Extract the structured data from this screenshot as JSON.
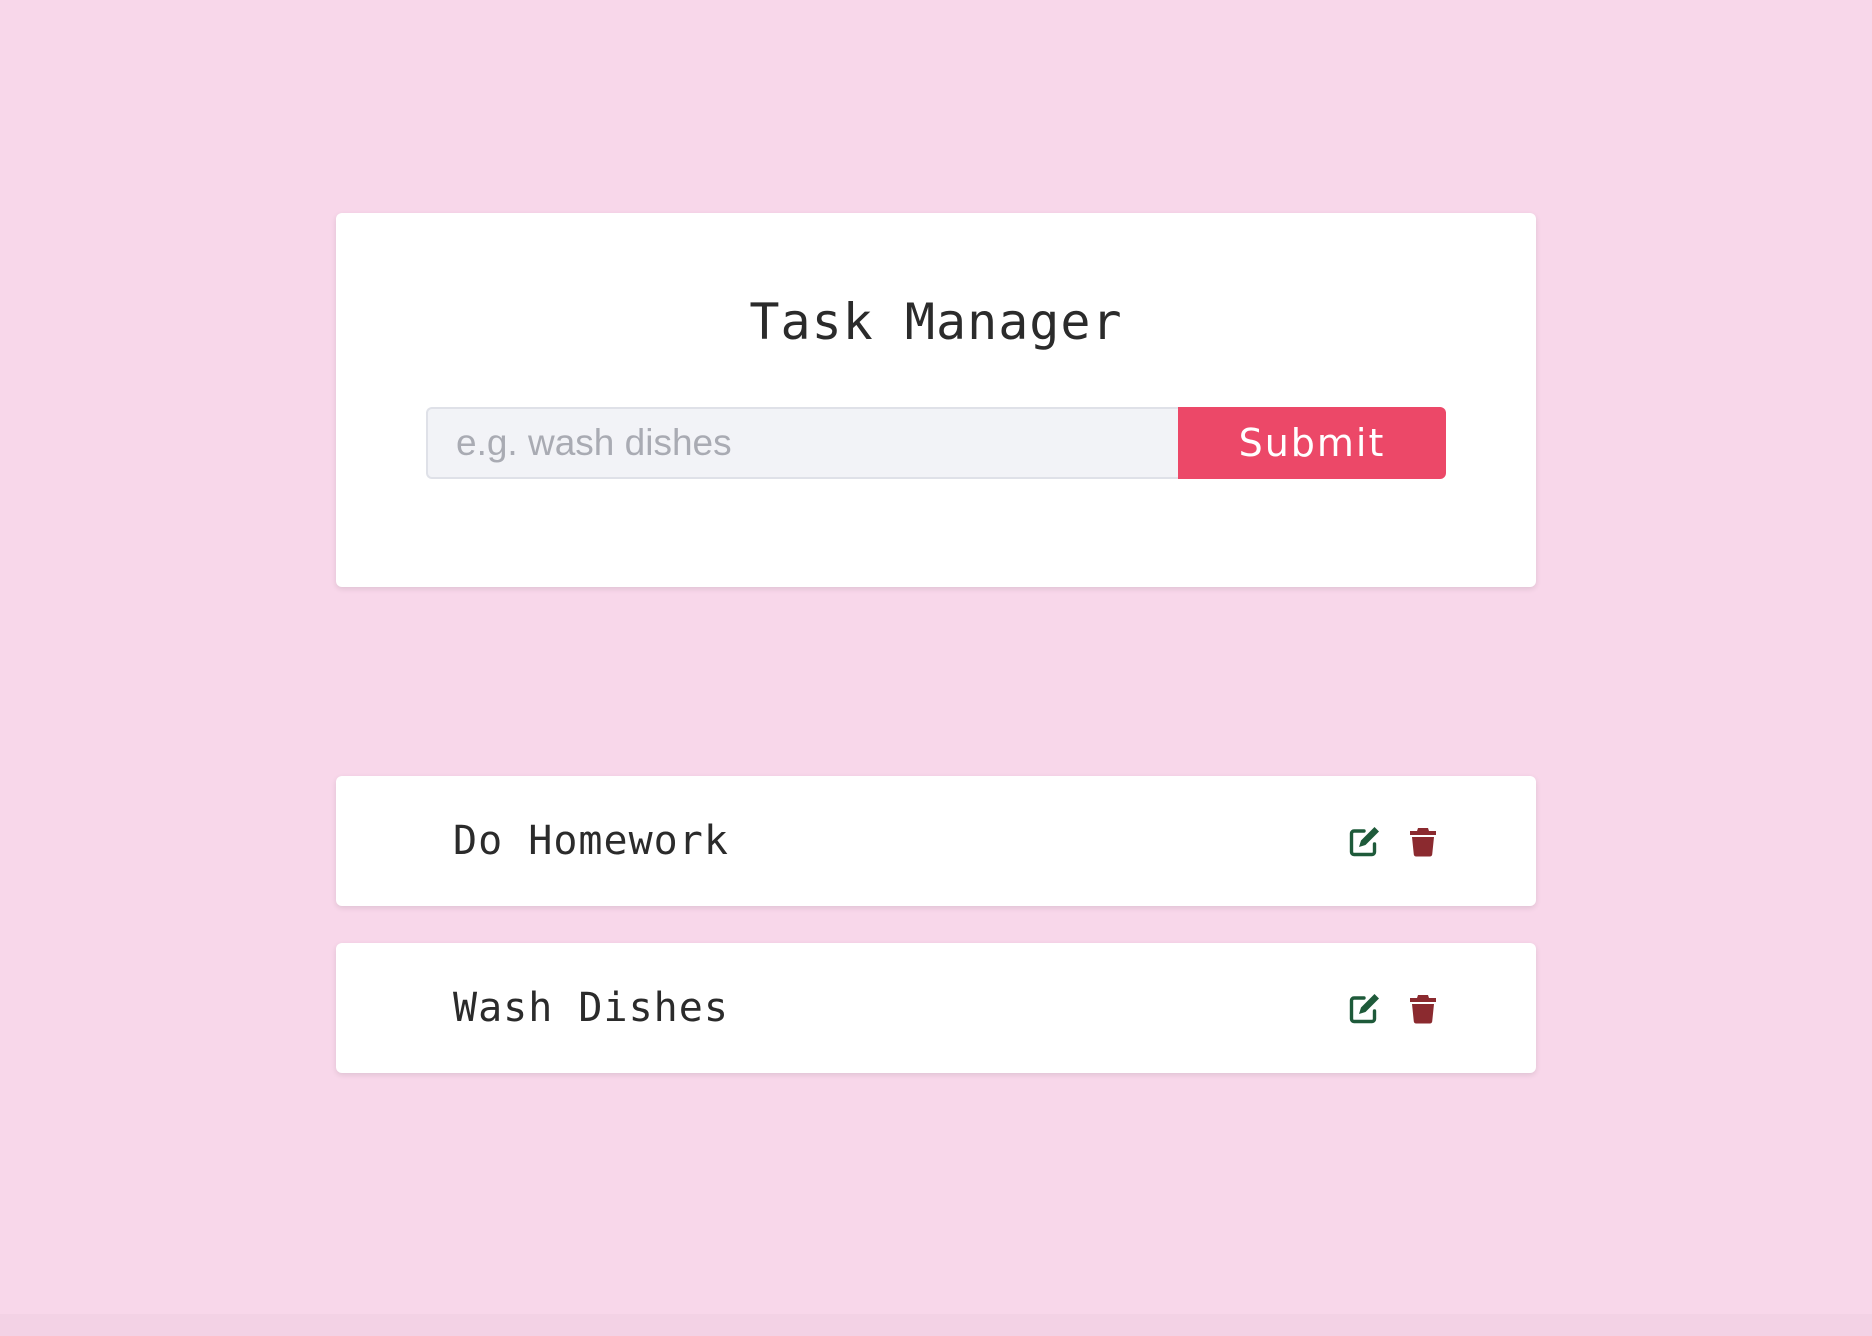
{
  "app": {
    "title": "Task Manager"
  },
  "form": {
    "input_value": "",
    "input_placeholder": "e.g. wash dishes",
    "submit_label": "Submit"
  },
  "tasks": [
    {
      "label": "Do Homework",
      "edit_icon": "edit-icon",
      "delete_icon": "trash-icon"
    },
    {
      "label": "Wash Dishes",
      "edit_icon": "edit-icon",
      "delete_icon": "trash-icon"
    }
  ],
  "colors": {
    "background": "#f8d7ea",
    "accent": "#ec4868",
    "edit_icon": "#1e5a3a",
    "delete_icon": "#8b2a2f",
    "text": "#2b2b2b"
  }
}
